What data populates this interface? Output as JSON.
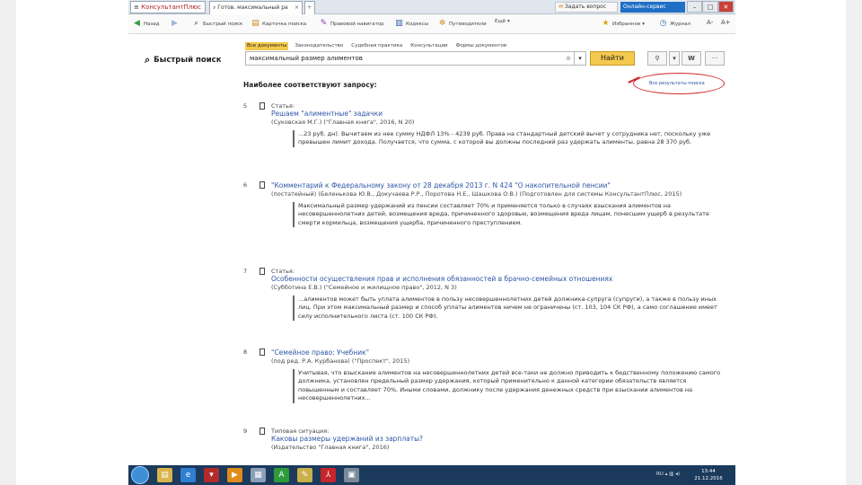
{
  "app": {
    "menu_label": "КонсультантПлюс",
    "tab_title": "Готов. максимальный ра",
    "ask_button": "Задать вопрос",
    "online_button": "Онлайн-сервис"
  },
  "toolbar": {
    "back": "Назад",
    "forward": "",
    "quick_search": "Быстрый поиск",
    "legal_map": "Карточка поиска",
    "navigator": "Правовой навигатор",
    "codes": "Кодексы",
    "reviews": "Путеводители",
    "more": "Ещё",
    "favorites": "Избранное",
    "history": "Журнал",
    "font_minus": "А-",
    "font_plus": "А+"
  },
  "search": {
    "label": "Быстрый поиск",
    "tabs": [
      "Все документы",
      "Законодательство",
      "Судебная практика",
      "Консультации",
      "Формы документов"
    ],
    "query": "максимальный размер алиментов",
    "find_button": "Найти",
    "buttons": [
      "",
      "",
      "W",
      "···"
    ]
  },
  "results_heading": "Наиболее соответствуют запросу:",
  "all_results_link": "Все результаты поиска",
  "results": [
    {
      "num": "5",
      "type": "Статья:",
      "title": "Решаем \"алиментные\" задачки",
      "meta": "(Суковская М.Г.) (\"Главная книга\", 2016, N 20)",
      "snippet": "...23 руб. дн). Вычитаем из нее сумму НДФЛ 13% - 4239 руб. Права на стандартный детский вычет у сотрудника нет, поскольку уже превышен лимит дохода. Получается, что сумма, с которой вы должны последний раз удержать алименты, равна 28 370 руб."
    },
    {
      "num": "6",
      "type": "",
      "title": "\"Комментарий к Федеральному закону от 28 декабря 2013 г. N 424 \"О накопительной пенсии\"",
      "meta": "(постатейный) (Беленькова Ю.В., Докучаева Р.Р., Поротова Н.Е., Шашкова О.В.) (Подготовлен для системы КонсультантПлюс, 2015)",
      "snippet": "Максимальный размер удержаний из пенсии составляет 70% и применяется только в случаях взыскания алиментов на несовершеннолетних детей, возмещения вреда, причиненного здоровью, возмещения вреда лицам, понесшим ущерб в результате смерти кормильца, возмещения ущерба, причиненного преступлением."
    },
    {
      "num": "7",
      "type": "Статья:",
      "title": "Особенности осуществления прав и исполнения обязанностей в брачно-семейных отношениях",
      "meta": "(Субботина Е.В.) (\"Семейное и жилищное право\", 2012, N 3)",
      "snippet": "...алиментов может быть уплата алиментов в пользу несовершеннолетних детей должника-супруга (супруги), а также в пользу иных лиц. При этом максимальный размер и способ уплаты алиментов ничем не ограничены (ст. 103, 104 СК РФ), а само соглашение имеет силу исполнительного листа (ст. 100 СК РФ)."
    },
    {
      "num": "8",
      "type": "",
      "title": "\"Семейное право: Учебник\"",
      "meta": "(под ред. Р.А. Курбанова) (\"Проспект\", 2015)",
      "snippet": "Учитывая, что взыскание алиментов на несовершеннолетних детей все-таки не должно приводить к бедственному положению самого должника, установлен предельный размер удержания, который применительно к данной категории обязательств является повышенным и составляет 70%. Иными словами, должнику после удержания денежных средств при взыскании алиментов на несовершеннолетних..."
    },
    {
      "num": "9",
      "type": "Типовая ситуация:",
      "title": "Каковы размеры удержаний из зарплаты?",
      "meta": "(Издательство \"Главная книга\", 2016)",
      "snippet": ""
    }
  ],
  "taskbar": {
    "tray_lang": "RU",
    "clock_time": "13:44",
    "clock_date": "21.12.2016"
  }
}
